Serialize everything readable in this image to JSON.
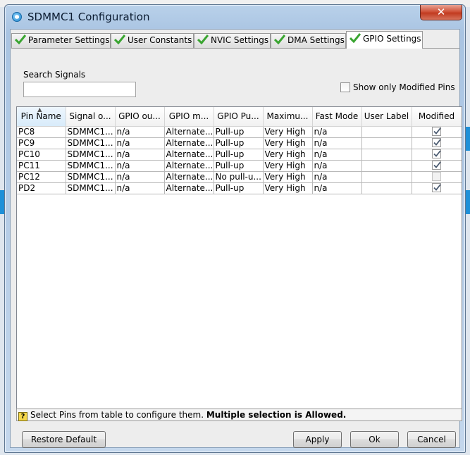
{
  "window": {
    "title": "SDMMC1 Configuration",
    "close_label": "✕"
  },
  "tabs": [
    {
      "label": "Parameter Settings",
      "active": false
    },
    {
      "label": "User Constants",
      "active": false
    },
    {
      "label": "NVIC Settings",
      "active": false
    },
    {
      "label": "DMA Settings",
      "active": false
    },
    {
      "label": "GPIO Settings",
      "active": true
    }
  ],
  "search": {
    "label": "Search Signals",
    "value": ""
  },
  "filter": {
    "label": "Show only Modified Pins",
    "checked": false
  },
  "table": {
    "headers": [
      "Pin Name",
      "Signal o...",
      "GPIO ou...",
      "GPIO m...",
      "GPIO Pu...",
      "Maximu...",
      "Fast Mode",
      "User Label",
      "Modified"
    ],
    "sorted_column": "Pin Name",
    "rows": [
      {
        "pin": "PC8",
        "signal": "SDMMC1...",
        "gpio_out": "n/a",
        "gpio_mode": "Alternate...",
        "pull": "Pull-up",
        "speed": "Very High",
        "fast": "n/a",
        "label": "",
        "modified": true
      },
      {
        "pin": "PC9",
        "signal": "SDMMC1...",
        "gpio_out": "n/a",
        "gpio_mode": "Alternate...",
        "pull": "Pull-up",
        "speed": "Very High",
        "fast": "n/a",
        "label": "",
        "modified": true
      },
      {
        "pin": "PC10",
        "signal": "SDMMC1...",
        "gpio_out": "n/a",
        "gpio_mode": "Alternate...",
        "pull": "Pull-up",
        "speed": "Very High",
        "fast": "n/a",
        "label": "",
        "modified": true
      },
      {
        "pin": "PC11",
        "signal": "SDMMC1...",
        "gpio_out": "n/a",
        "gpio_mode": "Alternate...",
        "pull": "Pull-up",
        "speed": "Very High",
        "fast": "n/a",
        "label": "",
        "modified": true
      },
      {
        "pin": "PC12",
        "signal": "SDMMC1...",
        "gpio_out": "n/a",
        "gpio_mode": "Alternate...",
        "pull": "No pull-u...",
        "speed": "Very High",
        "fast": "n/a",
        "label": "",
        "modified": false
      },
      {
        "pin": "PD2",
        "signal": "SDMMC1...",
        "gpio_out": "n/a",
        "gpio_mode": "Alternate...",
        "pull": "Pull-up",
        "speed": "Very High",
        "fast": "n/a",
        "label": "",
        "modified": true
      }
    ]
  },
  "hint": {
    "icon": "?",
    "text": "Select Pins from table to configure them.",
    "bold": "Multiple selection is Allowed."
  },
  "buttons": {
    "restore": "Restore Default",
    "apply": "Apply",
    "ok": "Ok",
    "cancel": "Cancel"
  },
  "colors": {
    "check_green": "#3aa531",
    "title_bar": "#b9d1ea",
    "close_red": "#c74a2f"
  }
}
